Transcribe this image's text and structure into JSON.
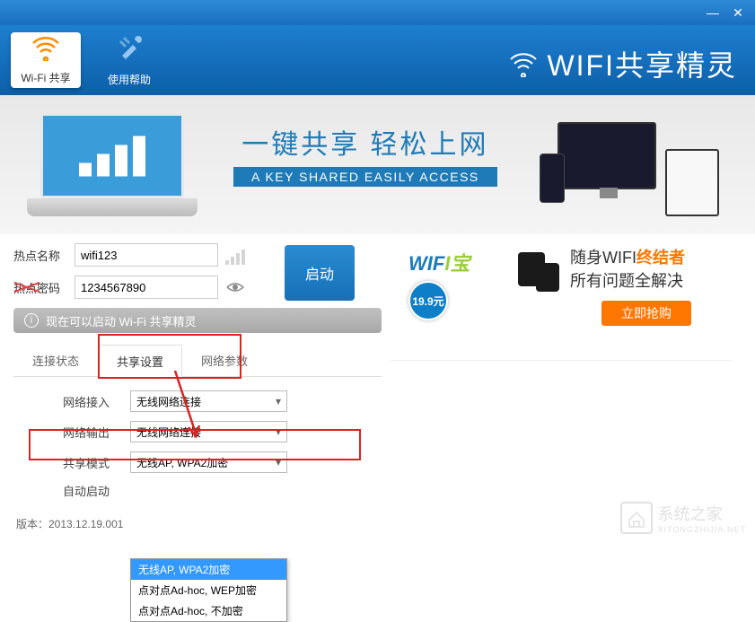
{
  "titlebar": {
    "minimize": "—",
    "close": "✕"
  },
  "toolbar": {
    "wifi_share": {
      "label": "Wi-Fi 共享",
      "icon": "📶"
    },
    "help": {
      "label": "使用帮助",
      "icon": "🛠"
    }
  },
  "logo": "WIFI共享精灵",
  "banner": {
    "title": "一键共享 轻松上网",
    "subtitle": "A KEY SHARED EASILY ACCESS"
  },
  "form": {
    "name_label": "热点名称",
    "name_value": "wifi123",
    "pwd_label": "热点密码",
    "pwd_value": "1234567890",
    "start_button": "启动"
  },
  "status": "现在可以启动 Wi-Fi 共享精灵",
  "tabs": {
    "connection": "连接状态",
    "settings": "共享设置",
    "network": "网络参数"
  },
  "settings": {
    "access_label": "网络接入",
    "access_value": "无线网络连接",
    "output_label": "网络输出",
    "output_value": "无线网络连接",
    "mode_label": "共享模式",
    "mode_value": "无线AP, WPA2加密",
    "autostart_label": "自动启动"
  },
  "dropdown_options": [
    "无线AP, WPA2加密",
    "点对点Ad-hoc, WEP加密",
    "点对点Ad-hoc, 不加密"
  ],
  "promo": {
    "logo_prefix": "WIF",
    "logo_suffix": "I宝",
    "price": "19.9元",
    "line1a": "随身WIFI",
    "line1b": "终结者",
    "line2": "所有问题全解决",
    "button": "立即抢购"
  },
  "footer": "版本：2013.12.19.001",
  "watermark": {
    "main": "系统之家",
    "sub": "XITONGZHIJIA.NET"
  }
}
